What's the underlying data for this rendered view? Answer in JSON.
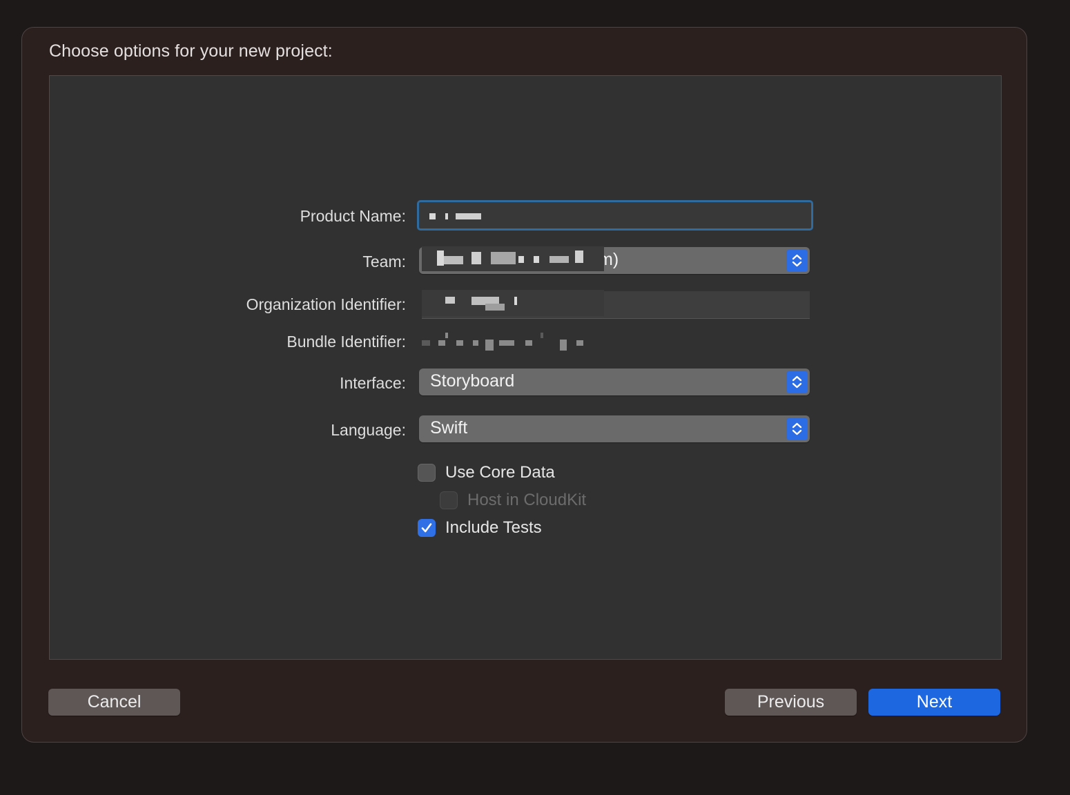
{
  "dialog": {
    "title": "Choose options for your new project:"
  },
  "form": {
    "product_name": {
      "label": "Product Name:",
      "value": ""
    },
    "team": {
      "label": "Team:",
      "visible_suffix": "m)"
    },
    "organization_identifier": {
      "label": "Organization Identifier:"
    },
    "bundle_identifier": {
      "label": "Bundle Identifier:"
    },
    "interface": {
      "label": "Interface:",
      "value": "Storyboard"
    },
    "language": {
      "label": "Language:",
      "value": "Swift"
    },
    "checkboxes": [
      {
        "label": "Use Core Data",
        "checked": false,
        "enabled": true
      },
      {
        "label": "Host in CloudKit",
        "checked": false,
        "enabled": false
      },
      {
        "label": "Include Tests",
        "checked": true,
        "enabled": true
      }
    ]
  },
  "buttons": {
    "cancel": "Cancel",
    "previous": "Previous",
    "next": "Next"
  },
  "colors": {
    "accent": "#1d67e0",
    "focus_ring": "#2f6b9e",
    "sheet_background": "#2c201f",
    "panel_background": "#313131"
  },
  "icons": {
    "popup_stepper": "chevron-up-down-icon",
    "checkmark": "checkmark-icon"
  }
}
